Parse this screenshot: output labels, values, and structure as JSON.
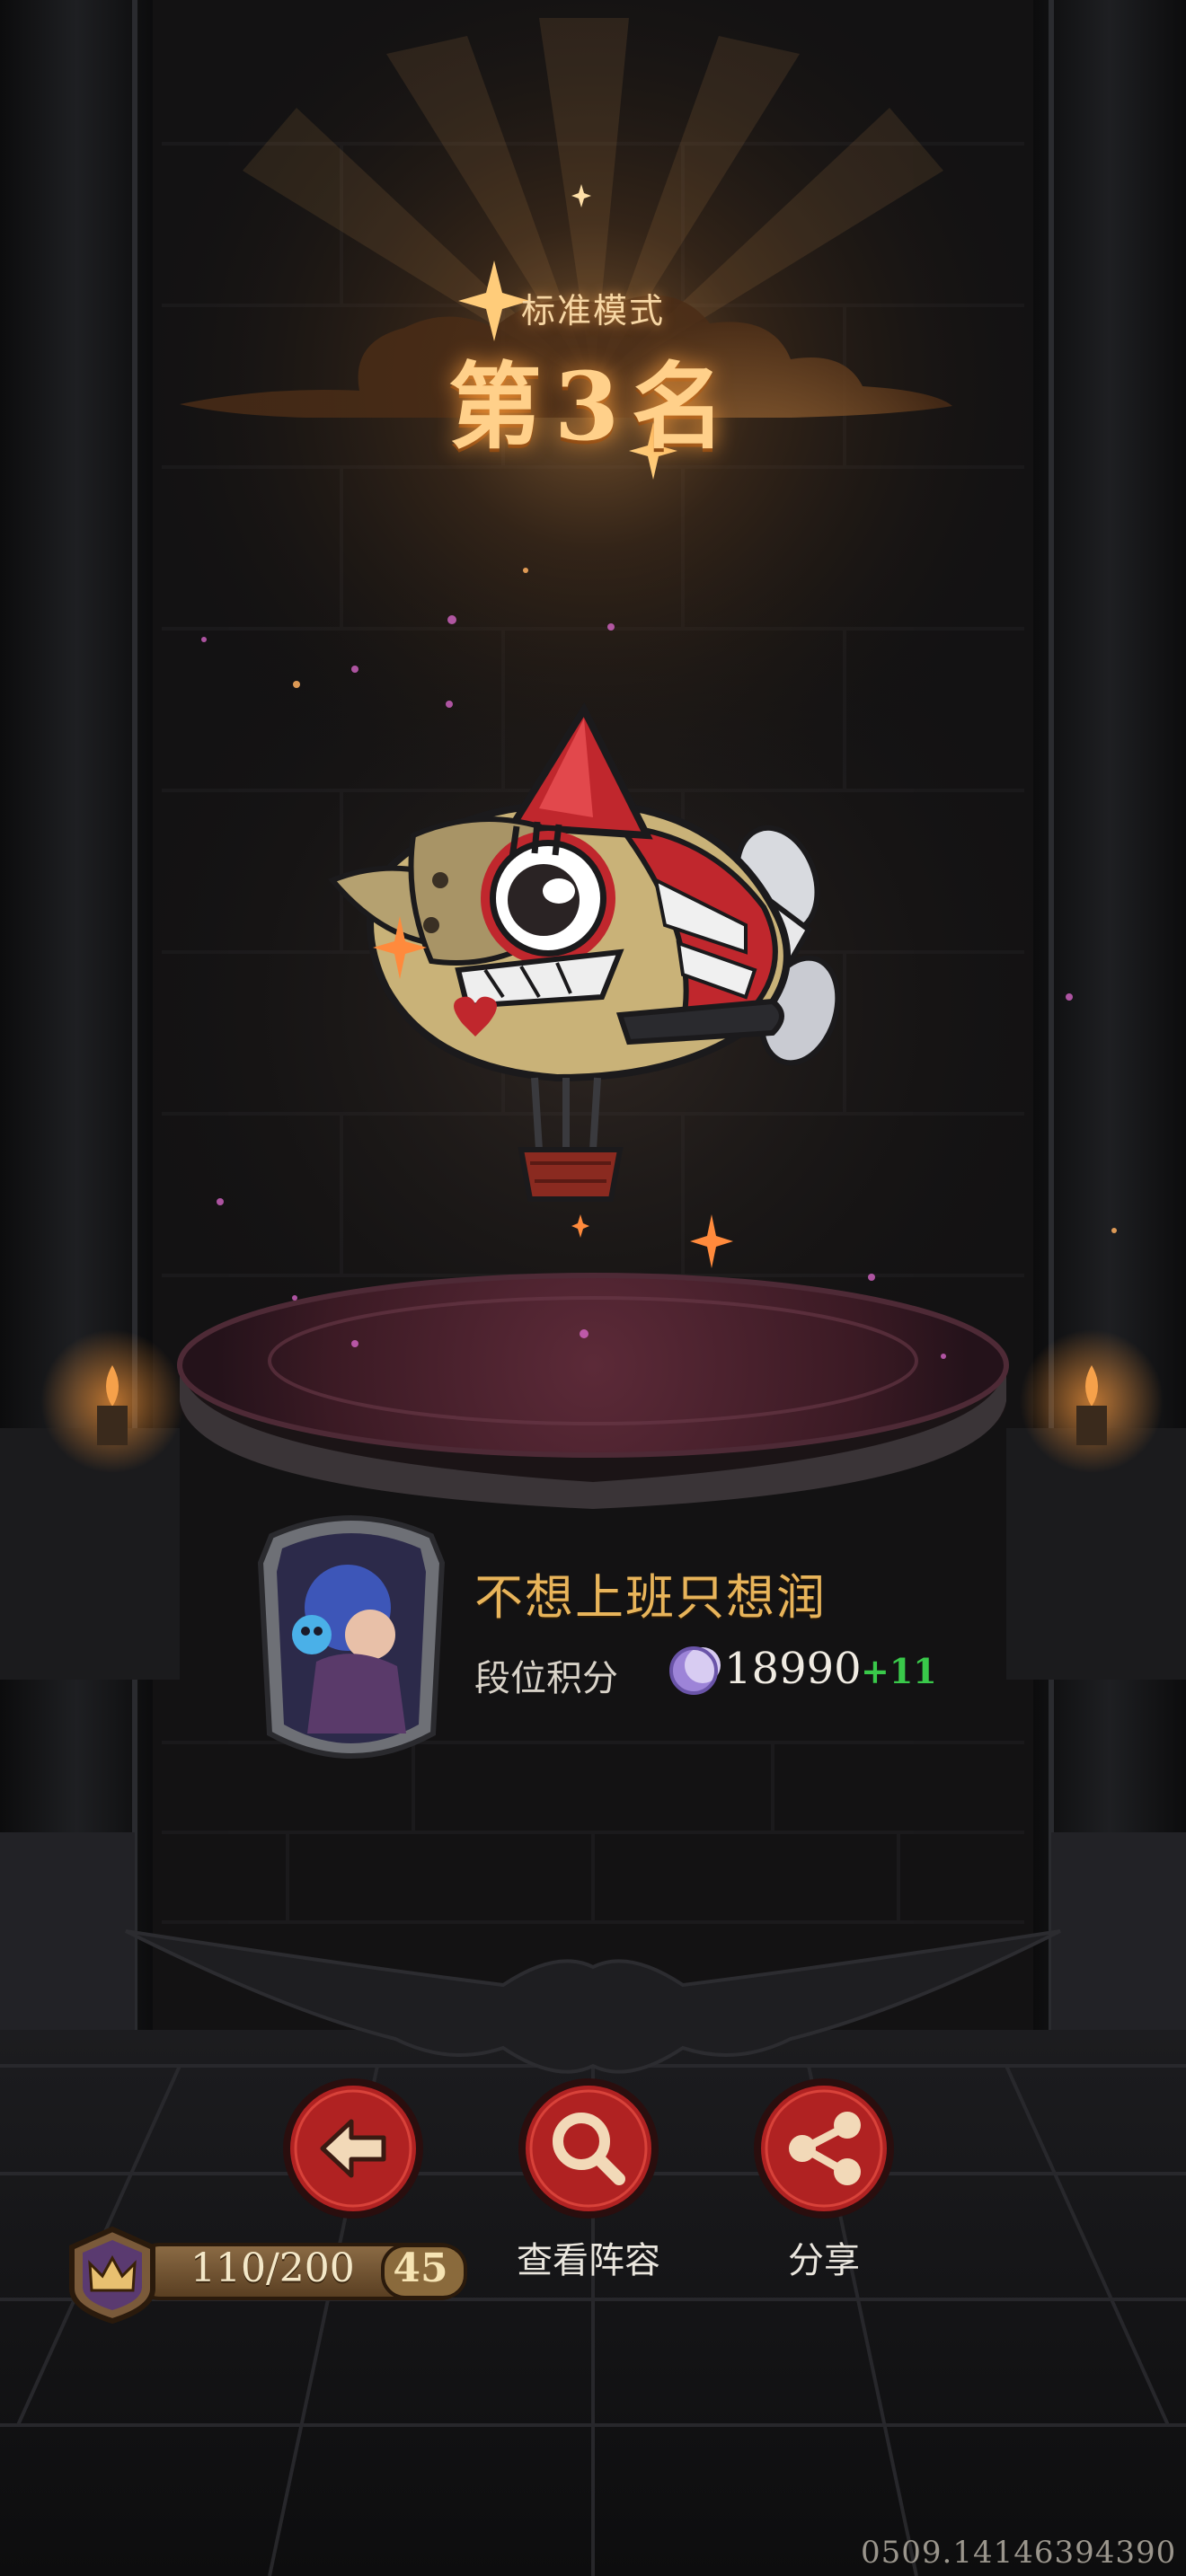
{
  "result": {
    "mode": "标准模式",
    "rank_text": "第3名"
  },
  "player": {
    "name": "不想上班只想润",
    "score_label": "段位积分",
    "score_value": "18990",
    "score_delta": "+11"
  },
  "actions": {
    "back_label": "返回",
    "view_lineup_label": "查看阵容",
    "share_label": "分享"
  },
  "level": {
    "progress": "110/200",
    "number": "45"
  },
  "build_id": "0509.14146394390",
  "colors": {
    "accent_gold": "#ffd08a",
    "name_gold": "#e8b45a",
    "delta_green": "#39c94a",
    "button_red": "#b02222"
  }
}
